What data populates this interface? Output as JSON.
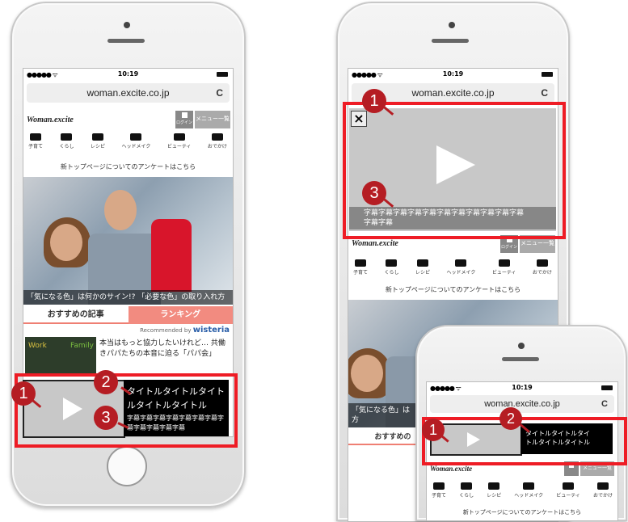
{
  "colors": {
    "callout_red": "#ee1c25",
    "badge_red": "#b51d23",
    "tab_pink": "#f28b80",
    "player_gray": "#c8c8c8"
  },
  "status": {
    "signal": "●●●●● ᯤ",
    "time": "10:19"
  },
  "browser": {
    "url": "woman.excite.co.jp",
    "reload_icon": "C"
  },
  "site": {
    "logo": "Woman.excite",
    "login": "ログイン",
    "menu": "メニュー一覧",
    "categories": [
      "子育て",
      "くらし",
      "レシピ",
      "ヘッドメイク",
      "ビューティ",
      "おでかけ"
    ],
    "notice": "新トップページについてのアンケートはこちら",
    "hero_caption": "「気になる色」は何かのサイン!? 「必要な色」の取り入れ方",
    "hero_caption_short": "「気になる色」は",
    "hero_caption_tail": "方"
  },
  "tabs": {
    "recommended": "おすすめの記事",
    "ranking": "ランキング",
    "recommended_short": "おすすめの"
  },
  "recommend": {
    "by": "Recommended by",
    "brand": "wisteria"
  },
  "article": {
    "thumb_work": "Work",
    "thumb_family": "Family",
    "text": "本当はもっと協力したいけれど… 共働きパパたちの本音に迫る「パパ会」"
  },
  "video": {
    "title": "タイトルタイトルタイトルタイトルタイトル",
    "title_line1": "タイトルタイトルタイ",
    "title_line2": "トルタイトルタイトル",
    "subtitle": "字幕字幕字幕字幕字幕字幕字幕字幕字幕字幕字幕字幕",
    "subtitle_line1": "字幕字幕字幕字幕字幕字幕字幕字幕字幕字幕字幕",
    "subtitle_line2": "字幕字幕",
    "close": "×"
  },
  "badges": {
    "one": "1",
    "two": "2",
    "three": "3"
  }
}
